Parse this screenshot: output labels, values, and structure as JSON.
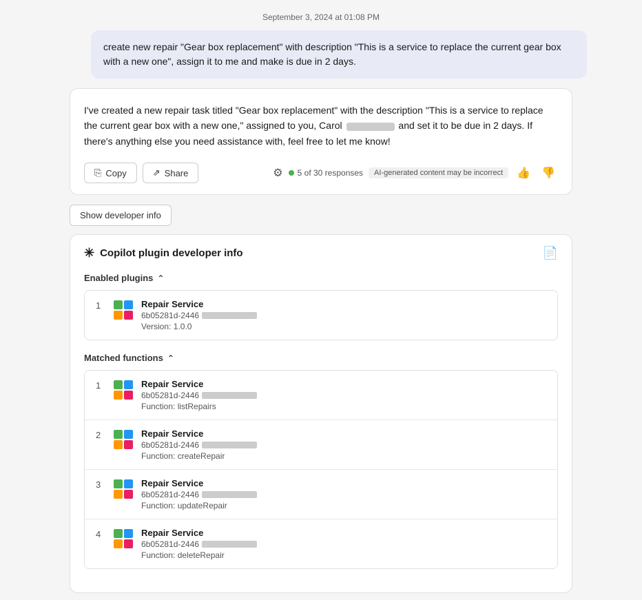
{
  "timestamp": "September 3, 2024 at 01:08 PM",
  "userMessage": "create new repair \"Gear box replacement\" with description \"This is a service to replace the current gear box with a new one\", assign it to me and make is due in 2 days.",
  "aiResponse": {
    "text_before": "I've created a new repair task titled \"Gear box replacement\" with the description \"This is a service to replace the current gear box with a new one,\" assigned to you, Carol",
    "text_after": "and set it to be due in 2 days. If there's anything else you need assistance with, feel free to let me know!",
    "copy_label": "Copy",
    "share_label": "Share",
    "responses_count": "5 of 30 responses",
    "ai_badge": "AI-generated content may be incorrect"
  },
  "dev_section": {
    "show_dev_btn": "Show developer info",
    "title": "Copilot plugin developer info",
    "enabled_plugins_label": "Enabled plugins",
    "matched_functions_label": "Matched functions",
    "enabled_plugins": [
      {
        "index": "1",
        "name": "Repair Service",
        "id": "6b05281d-2446",
        "version": "Version: 1.0.0"
      }
    ],
    "matched_functions": [
      {
        "index": "1",
        "name": "Repair Service",
        "id": "6b05281d-2446",
        "function": "Function: listRepairs"
      },
      {
        "index": "2",
        "name": "Repair Service",
        "id": "6b05281d-2446",
        "function": "Function: createRepair"
      },
      {
        "index": "3",
        "name": "Repair Service",
        "id": "6b05281d-2446",
        "function": "Function: updateRepair"
      },
      {
        "index": "4",
        "name": "Repair Service",
        "id": "6b05281d-2446",
        "function": "Function: deleteRepair"
      }
    ]
  }
}
